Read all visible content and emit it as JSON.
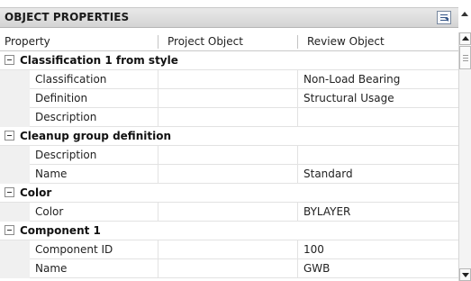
{
  "palette": {
    "title": "OBJECT PROPERTIES"
  },
  "columns": {
    "property": "Property",
    "project": "Project Object",
    "review": "Review Object"
  },
  "rows": [
    {
      "kind": "category",
      "label": "Classification 1 from style"
    },
    {
      "kind": "property",
      "name": "Classification",
      "project": "",
      "review": "Non-Load Bearing"
    },
    {
      "kind": "property",
      "name": "Definition",
      "project": "",
      "review": "Structural Usage"
    },
    {
      "kind": "property",
      "name": "Description",
      "project": "",
      "review": ""
    },
    {
      "kind": "category",
      "label": "Cleanup group definition"
    },
    {
      "kind": "property",
      "name": "Description",
      "project": "",
      "review": ""
    },
    {
      "kind": "property",
      "name": "Name",
      "project": "",
      "review": "Standard"
    },
    {
      "kind": "category",
      "label": "Color"
    },
    {
      "kind": "property",
      "name": "Color",
      "project": "",
      "review": "BYLAYER"
    },
    {
      "kind": "category",
      "label": "Component 1"
    },
    {
      "kind": "property",
      "name": "Component ID",
      "project": "",
      "review": "100"
    },
    {
      "kind": "property",
      "name": "Name",
      "project": "",
      "review": "GWB"
    }
  ]
}
